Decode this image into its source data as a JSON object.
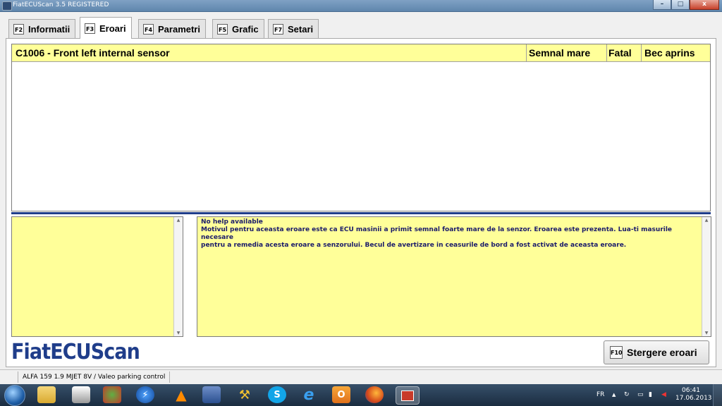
{
  "window": {
    "title": "FiatECUScan 3.5 REGISTERED",
    "buttons": {
      "minimize": "–",
      "maximize": "□",
      "close": "x"
    }
  },
  "tabs": [
    {
      "key": "F2",
      "label": "Informatii",
      "active": false
    },
    {
      "key": "F3",
      "label": "Eroari",
      "active": true
    },
    {
      "key": "F4",
      "label": "Parametri",
      "active": false
    },
    {
      "key": "F5",
      "label": "Grafic",
      "active": false
    },
    {
      "key": "F7",
      "label": "Setari",
      "active": false
    }
  ],
  "errors_table": {
    "columns": [
      "C1006 - Front left internal sensor",
      "Semnal mare",
      "Fatal",
      "Bec aprins"
    ],
    "rows": []
  },
  "help": {
    "lines": [
      "No help available",
      "Motivul pentru aceasta eroare este ca ECU masinii a primit semnal foarte mare de la senzor.  Eroarea este prezenta. Lua-ti masurile necesare",
      "pentru a remedia acesta eroare a senzorului.  Becul de avertizare in ceasurile de bord a fost activat de aceasta eroare."
    ]
  },
  "logo": "FiatECUScan",
  "clear_button": {
    "key": "F10",
    "label": "Stergere eroari"
  },
  "status": {
    "vehicle": "ALFA 159 1.9 MJET 8V / Valeo parking control"
  },
  "taskbar": {
    "language": "FR",
    "time": "06:41",
    "date": "17.06.2013",
    "icons": [
      "explorer-icon",
      "app-icon",
      "security-icon",
      "speed-icon",
      "vlc-icon",
      "network-icon",
      "tools-icon",
      "skype-icon",
      "ie-icon",
      "outlook-icon",
      "firefox-icon",
      "fiatecuscan-icon"
    ]
  },
  "colors": {
    "accent": "#1f3d8a",
    "highlight_yellow": "#ffff99",
    "titlebar": "#6f93b8"
  }
}
